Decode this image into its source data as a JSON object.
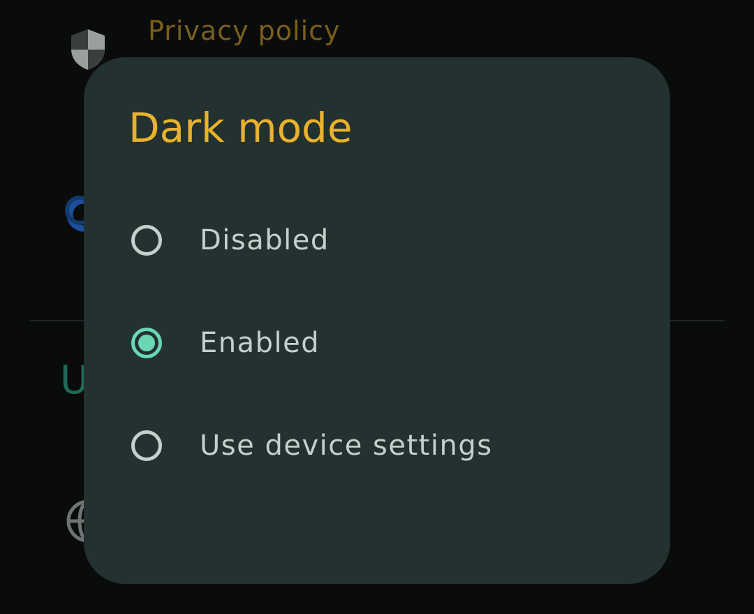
{
  "background": {
    "privacy_label": "Privacy policy",
    "section_letter": "U",
    "icons": [
      "shield-icon",
      "blue-circle-icon",
      "globe-icon"
    ]
  },
  "dialog": {
    "title": "Dark mode",
    "options": [
      {
        "label": "Disabled",
        "selected": false
      },
      {
        "label": "Enabled",
        "selected": true
      },
      {
        "label": "Use device settings",
        "selected": false
      }
    ]
  },
  "colors": {
    "page_bg": "#0a0c0c",
    "dialog_bg": "#233130",
    "title": "#e9b22c",
    "accent": "#6ad7b5",
    "option_text": "#c6cfcc",
    "privacy_text": "#7a5f1c",
    "section_text": "#1f6a56"
  }
}
